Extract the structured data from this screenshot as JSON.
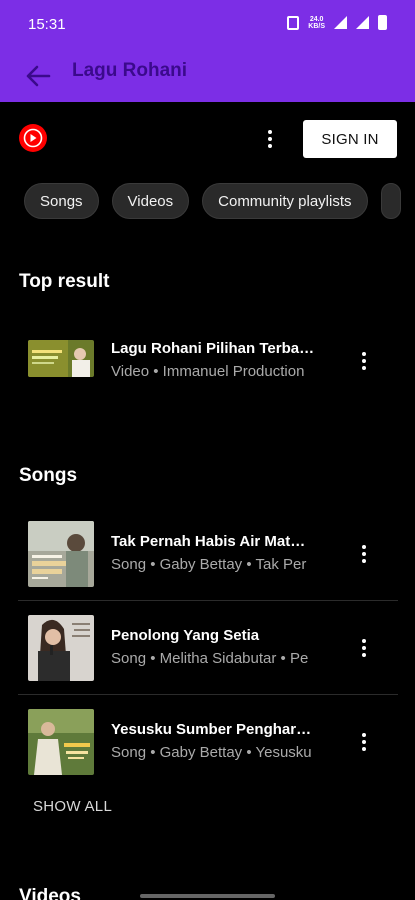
{
  "status": {
    "time": "15:31",
    "speed_top": "24.0",
    "speed_unit": "KB/S"
  },
  "appbar": {
    "title": "Lagu Rohani"
  },
  "header": {
    "signin_label": "SIGN IN"
  },
  "chips": [
    "Songs",
    "Videos",
    "Community playlists"
  ],
  "top_result": {
    "heading": "Top result",
    "item": {
      "title": "Lagu Rohani Pilihan Terba…",
      "subtitle": "Video • Immanuel Production"
    }
  },
  "songs": {
    "heading": "Songs",
    "items": [
      {
        "title": "Tak Pernah Habis Air Mat…",
        "subtitle": "Song • Gaby Bettay • Tak Per"
      },
      {
        "title": "Penolong Yang Setia",
        "subtitle": "Song • Melitha Sidabutar • Pe"
      },
      {
        "title": "Yesusku Sumber Penghar…",
        "subtitle": "Song • Gaby Bettay • Yesusku"
      }
    ],
    "show_all": "SHOW ALL"
  },
  "videos": {
    "heading": "Videos"
  },
  "colors": {
    "appbar": "#7c2ee6",
    "title": "#3b0a8c",
    "background": "#000000",
    "ytm_red": "#ff0000"
  }
}
